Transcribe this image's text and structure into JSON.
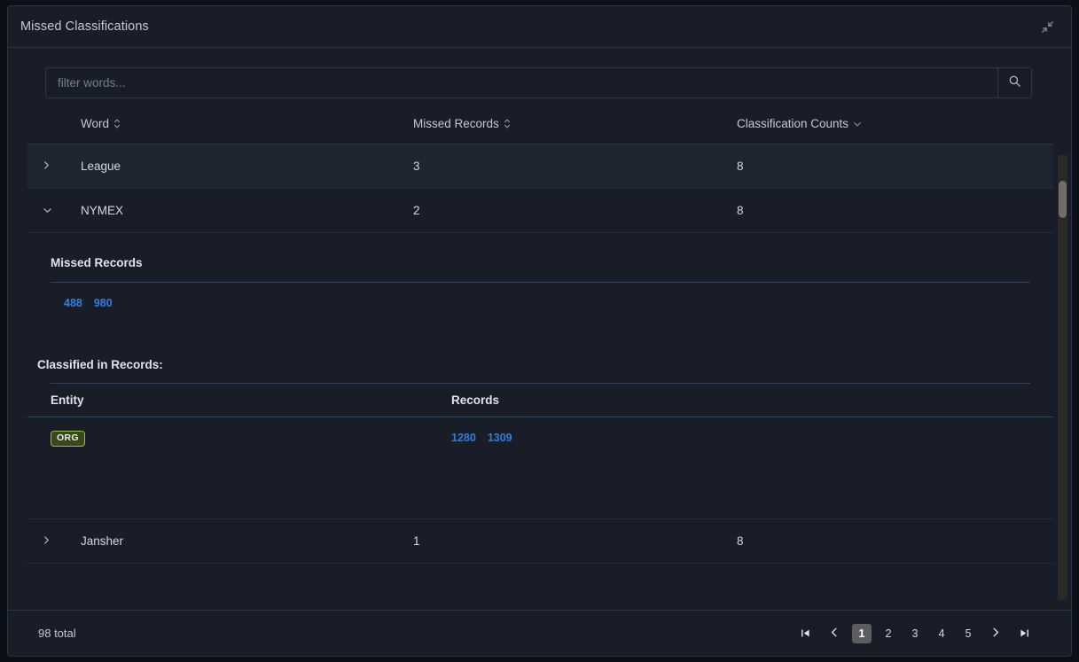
{
  "header": {
    "title": "Missed Classifications",
    "collapse_icon": "collapse-arrows-icon"
  },
  "search": {
    "placeholder": "filter words...",
    "value": "",
    "button_icon": "search-icon"
  },
  "table": {
    "columns": [
      {
        "label": "Word",
        "sort_icon": "sort-updown-icon"
      },
      {
        "label": "Missed Records",
        "sort_icon": "sort-updown-icon"
      },
      {
        "label": "Classification Counts",
        "sort_icon": "chevron-down-icon"
      }
    ],
    "rows": [
      {
        "word": "League",
        "missed_records": "3",
        "classification_counts": "8",
        "expanded": false,
        "toggle_icon": "chevron-right-icon"
      },
      {
        "word": "NYMEX",
        "missed_records": "2",
        "classification_counts": "8",
        "expanded": true,
        "toggle_icon": "chevron-down-icon"
      },
      {
        "word": "Jansher",
        "missed_records": "1",
        "classification_counts": "8",
        "expanded": false,
        "toggle_icon": "chevron-right-icon"
      }
    ],
    "detail": {
      "missed_records_title": "Missed Records",
      "missed_record_links": [
        "488",
        "980"
      ],
      "classified_title": "Classified in Records:",
      "sub_columns": [
        "Entity",
        "Records"
      ],
      "sub_rows": [
        {
          "entity": "ORG",
          "records": [
            "1280",
            "1309"
          ]
        }
      ]
    }
  },
  "footer": {
    "total": "98 total",
    "pager": {
      "first_icon": "first-page-icon",
      "prev_icon": "chevron-left-icon",
      "pages": [
        "1",
        "2",
        "3",
        "4",
        "5"
      ],
      "active_page": "1",
      "next_icon": "chevron-right-icon",
      "last_icon": "last-page-icon"
    }
  },
  "colors": {
    "panel_bg": "#181d27",
    "page_bg": "#0b0f16",
    "link": "#2f7fe0",
    "badge_border": "#8ac43b",
    "badge_bg": "#3b4718",
    "active_page_bg": "#5d5d5d"
  }
}
